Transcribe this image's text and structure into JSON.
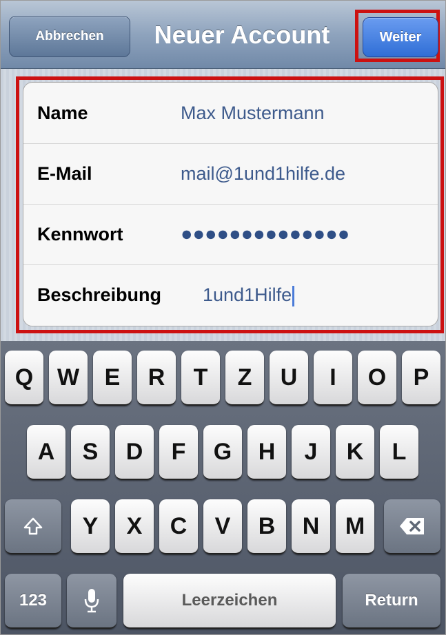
{
  "navbar": {
    "cancel_label": "Abbrechen",
    "title": "Neuer Account",
    "next_label": "Weiter"
  },
  "form": {
    "rows": [
      {
        "label": "Name",
        "value": "Max Mustermann"
      },
      {
        "label": "E-Mail",
        "value": "mail@1und1hilfe.de"
      },
      {
        "label": "Kennwort",
        "value": "●●●●●●●●●●●●●●"
      },
      {
        "label": "Beschreibung",
        "value": "1und1Hilfe"
      }
    ]
  },
  "keyboard": {
    "row1": [
      "Q",
      "W",
      "E",
      "R",
      "T",
      "Z",
      "U",
      "I",
      "O",
      "P"
    ],
    "row2": [
      "A",
      "S",
      "D",
      "F",
      "G",
      "H",
      "J",
      "K",
      "L"
    ],
    "row3": [
      "Y",
      "X",
      "C",
      "V",
      "B",
      "N",
      "M"
    ],
    "numbers_label": "123",
    "space_label": "Leerzeichen",
    "return_label": "Return",
    "shift_icon": "shift-arrow-icon",
    "delete_icon": "backspace-icon",
    "mic_icon": "microphone-icon"
  },
  "colors": {
    "highlight": "#cc1111",
    "next_button": "#2f6ed6",
    "value_text": "#3d5a8c"
  }
}
